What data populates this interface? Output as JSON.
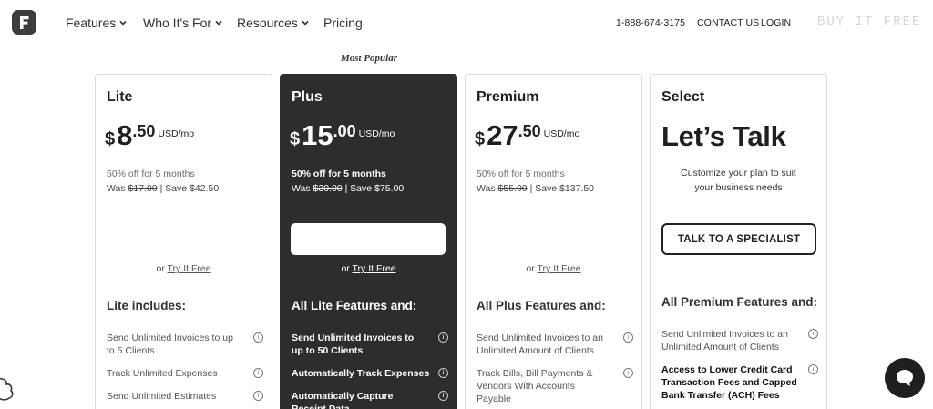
{
  "nav": {
    "links": [
      "Features",
      "Who It's For",
      "Resources",
      "Pricing"
    ],
    "phone": "1-888-674-3175",
    "contact": "CONTACT US",
    "login": "LOGIN",
    "faded_text": "BUY IT FREE"
  },
  "badge": "Most Popular",
  "plans": [
    {
      "name": "Lite",
      "dollar": "$",
      "whole": "8",
      "cents": ".50",
      "unit": "USD/mo",
      "discount": "50% off for 5 months",
      "was_prefix": "Was ",
      "was_price": "$17.00",
      "save": " | Save $42.50",
      "try_or": "or ",
      "try_link": "Try It Free",
      "includes": "Lite includes:",
      "features": [
        "Send Unlimited Invoices to up to 5 Clients",
        "Track Unlimited Expenses",
        "Send Unlimited Estimates"
      ]
    },
    {
      "name": "Plus",
      "dollar": "$",
      "whole": "15",
      "cents": ".00",
      "unit": "USD/mo",
      "discount": "50% off for 5 months",
      "was_prefix": "Was ",
      "was_price": "$30.00",
      "save": " | Save $75.00",
      "try_or": "or ",
      "try_link": "Try It Free",
      "includes": "All Lite Features and:",
      "features": [
        "Send Unlimited Invoices to up to 50 Clients",
        "Automatically Track Expenses",
        "Automatically Capture Receipt Data"
      ]
    },
    {
      "name": "Premium",
      "dollar": "$",
      "whole": "27",
      "cents": ".50",
      "unit": "USD/mo",
      "discount": "50% off for 5 months",
      "was_prefix": "Was ",
      "was_price": "$55.00",
      "save": " | Save $137.50",
      "try_or": "or ",
      "try_link": "Try It Free",
      "includes": "All Plus Features and:",
      "features": [
        "Send Unlimited Invoices to an Unlimited Amount of Clients",
        "Track Bills, Bill Payments & Vendors With Accounts Payable"
      ]
    },
    {
      "name": "Select",
      "headline": "Let’s Talk",
      "customize_1": "Customize your plan to suit",
      "customize_2": "your business needs",
      "cta": "TALK TO A SPECIALIST",
      "includes": "All Premium Features and:",
      "features": [
        "Send Unlimited Invoices to an Unlimited Amount of Clients",
        "Access to Lower Credit Card",
        "Transaction Fees and Capped Bank Transfer (ACH) Fees"
      ]
    }
  ],
  "colors": {
    "dark_card": "#2d2d2d",
    "accent": "#1f1f1f"
  }
}
